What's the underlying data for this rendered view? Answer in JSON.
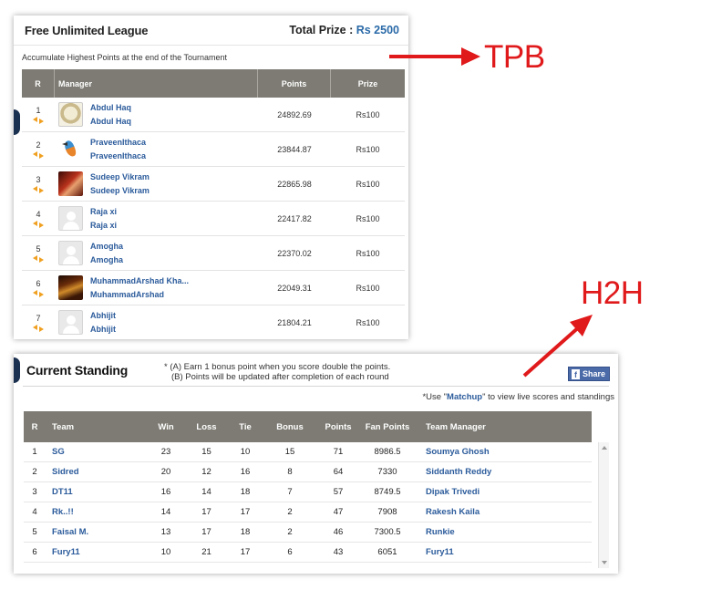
{
  "tpb": {
    "title": "Free Unlimited League",
    "prize_label": "Total Prize :",
    "prize_value": "Rs 2500",
    "subtitle": "Accumulate Highest Points at the end of the Tournament",
    "headers": {
      "rank": "R",
      "manager": "Manager",
      "points": "Points",
      "prize": "Prize"
    },
    "rows": [
      {
        "rank": "1",
        "name": "Abdul Haq",
        "team": "Abdul Haq",
        "points": "24892.69",
        "prize": "Rs100",
        "avatar": "medal-avatar"
      },
      {
        "rank": "2",
        "name": "PraveenIthaca",
        "team": "PraveenIthaca",
        "points": "23844.87",
        "prize": "Rs100",
        "avatar": "bird-avatar"
      },
      {
        "rank": "3",
        "name": "Sudeep Vikram",
        "team": "Sudeep Vikram",
        "points": "22865.98",
        "prize": "Rs100",
        "avatar": "photo-avatar"
      },
      {
        "rank": "4",
        "name": "Raja xi",
        "team": "Raja xi",
        "points": "22417.82",
        "prize": "Rs100",
        "avatar": "default-avatar"
      },
      {
        "rank": "5",
        "name": "Amogha",
        "team": "Amogha",
        "points": "22370.02",
        "prize": "Rs100",
        "avatar": "default-avatar"
      },
      {
        "rank": "6",
        "name": "MuhammadArshad Kha...",
        "team": "MuhammadArshad",
        "points": "22049.31",
        "prize": "Rs100",
        "avatar": "photo-avatar"
      },
      {
        "rank": "7",
        "name": "Abhijit",
        "team": "Abhijit",
        "points": "21804.21",
        "prize": "Rs100",
        "avatar": "default-avatar"
      }
    ]
  },
  "h2h": {
    "title": "Current Standing",
    "note1": "* (A) Earn 1 bonus point when you score double the points.",
    "note2": "(B) Points will be updated after completion of each round",
    "share_label": "Share",
    "use_prefix": "*Use \"",
    "use_link": "Matchup",
    "use_suffix": "\"   to view live scores and standings",
    "headers": {
      "rank": "R",
      "team": "Team",
      "win": "Win",
      "loss": "Loss",
      "tie": "Tie",
      "bonus": "Bonus",
      "points": "Points",
      "fan_points": "Fan Points",
      "manager": "Team Manager"
    },
    "rows": [
      {
        "rank": "1",
        "team": "SG",
        "win": "23",
        "loss": "15",
        "tie": "10",
        "bonus": "15",
        "points": "71",
        "fan": "8986.5",
        "manager": "Soumya Ghosh"
      },
      {
        "rank": "2",
        "team": "Sidred",
        "win": "20",
        "loss": "12",
        "tie": "16",
        "bonus": "8",
        "points": "64",
        "fan": "7330",
        "manager": "Siddanth Reddy"
      },
      {
        "rank": "3",
        "team": "DT11",
        "win": "16",
        "loss": "14",
        "tie": "18",
        "bonus": "7",
        "points": "57",
        "fan": "8749.5",
        "manager": "Dipak Trivedi"
      },
      {
        "rank": "4",
        "team": "Rk..!!",
        "win": "14",
        "loss": "17",
        "tie": "17",
        "bonus": "2",
        "points": "47",
        "fan": "7908",
        "manager": "Rakesh Kaila"
      },
      {
        "rank": "5",
        "team": "Faisal M.",
        "win": "13",
        "loss": "17",
        "tie": "18",
        "bonus": "2",
        "points": "46",
        "fan": "7300.5",
        "manager": "Runkie"
      },
      {
        "rank": "6",
        "team": "Fury11",
        "win": "10",
        "loss": "21",
        "tie": "17",
        "bonus": "6",
        "points": "43",
        "fan": "6051",
        "manager": "Fury11"
      }
    ]
  },
  "annotations": {
    "tpb": "TPB",
    "h2h": "H2H",
    "color": "#e0191b"
  }
}
